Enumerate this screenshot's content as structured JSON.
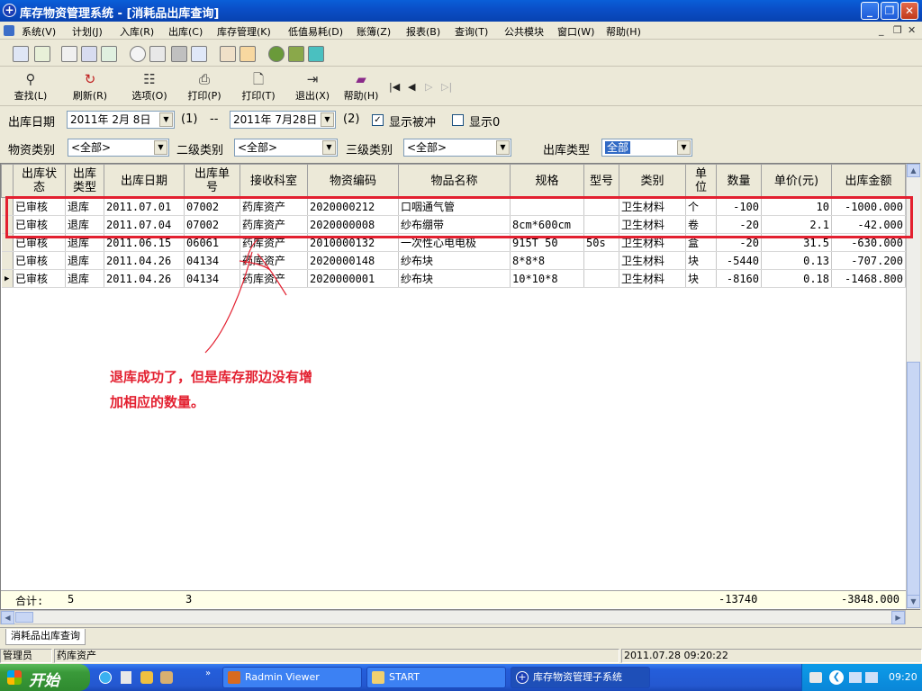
{
  "window": {
    "title": "库存物资管理系统 - [消耗品出库查询]",
    "buttons": [
      "_",
      "❐",
      "✕"
    ]
  },
  "menu": {
    "items": [
      "系统(V)",
      "计划(J)",
      "入库(R)",
      "出库(C)",
      "库存管理(K)",
      "低值易耗(D)",
      "账簿(Z)",
      "报表(B)",
      "查询(T)",
      "公共模块",
      "窗口(W)",
      "帮助(H)"
    ],
    "mdi_controls": [
      "_",
      "❐",
      "✕"
    ]
  },
  "toolbar": {
    "buttons": [
      {
        "label": "查找(L)",
        "icon": "magnifier-icon"
      },
      {
        "label": "刷新(R)",
        "icon": "refresh-icon"
      },
      {
        "label": "选项(O)",
        "icon": "options-icon"
      },
      {
        "label": "打印(P)",
        "icon": "printer-icon"
      },
      {
        "label": "打印(T)",
        "icon": "print-preview-icon"
      },
      {
        "label": "退出(X)",
        "icon": "exit-door-icon"
      },
      {
        "label": "帮助(H)",
        "icon": "help-book-icon"
      }
    ],
    "nav": [
      "|◀",
      "◀",
      "▷",
      "▷|"
    ]
  },
  "filters": {
    "date_label": "出库日期",
    "start_date": "2011年 2月 8日",
    "start_hotkey": "(1)",
    "sep": "--",
    "end_date": "2011年 7月28日",
    "end_hotkey": "(2)",
    "show_offset_label": "显示被冲",
    "show_offset_checked": true,
    "show_zero_label": "显示0",
    "show_zero_checked": false,
    "category_label": "物资类别",
    "category_value": "<全部>",
    "sub2_label": "二级类别",
    "sub2_value": "<全部>",
    "sub3_label": "三级类别",
    "sub3_value": "<全部>",
    "type_label": "出库类型",
    "type_value": "全部"
  },
  "grid": {
    "headers": [
      "出库状态",
      "出库类型",
      "出库日期",
      "出库单号",
      "接收科室",
      "物资编码",
      "物品名称",
      "规格",
      "型号",
      "类别",
      "单位",
      "数量",
      "单价(元)",
      "出库金额"
    ],
    "rows": [
      [
        "已审核",
        "退库",
        "2011.07.01",
        "07002",
        "药库资产",
        "2020000212",
        "口咽通气管",
        "",
        "",
        "卫生材料",
        "个",
        "-100",
        "10",
        "-1000.000"
      ],
      [
        "已审核",
        "退库",
        "2011.07.04",
        "07002",
        "药库资产",
        "2020000008",
        "纱布绷带",
        "8cm*600cm",
        "",
        "卫生材料",
        "卷",
        "-20",
        "2.1",
        "-42.000"
      ],
      [
        "已审核",
        "退库",
        "2011.06.15",
        "06061",
        "药库资产",
        "2010000132",
        "一次性心电电极",
        "915T 50",
        "50s",
        "卫生材料",
        "盒",
        "-20",
        "31.5",
        "-630.000"
      ],
      [
        "已审核",
        "退库",
        "2011.04.26",
        "04134",
        "药库资产",
        "2020000148",
        "纱布块",
        "8*8*8",
        "",
        "卫生材料",
        "块",
        "-5440",
        "0.13",
        "-707.200"
      ],
      [
        "已审核",
        "退库",
        "2011.04.26",
        "04134",
        "药库资产",
        "2020000001",
        "纱布块",
        "10*10*8",
        "",
        "卫生材料",
        "块",
        "-8160",
        "0.18",
        "-1468.800"
      ]
    ],
    "current_row_marker": "▶",
    "footer": {
      "label": "合计:",
      "count": "5",
      "doc_count": "3",
      "qty_total": "-13740",
      "amount_total": "-3848.000"
    }
  },
  "annotation": {
    "line1": "退库成功了，但是库存那边没有增",
    "line2": "加相应的数量。",
    "color": "#e32030"
  },
  "tabs": {
    "active": "消耗品出库查询"
  },
  "status": {
    "user_label": "管理员",
    "dept": "药库资产",
    "datetime": "2011.07.28 09:20:22"
  },
  "taskbar": {
    "start": "开始",
    "tasks": [
      "Radmin Viewer",
      "START",
      "库存物资管理子系统"
    ],
    "clock": "09:20"
  }
}
